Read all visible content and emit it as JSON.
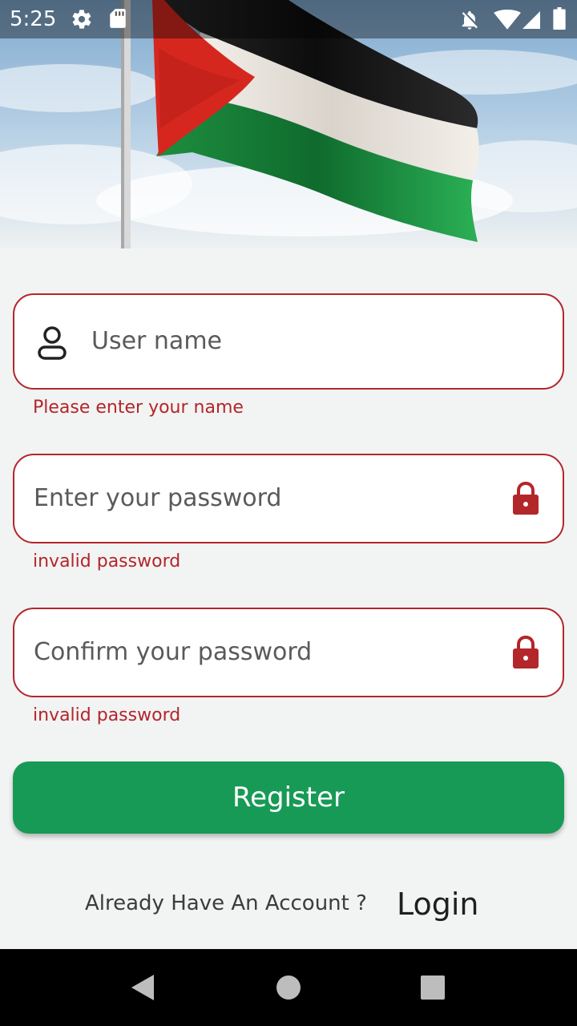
{
  "status_bar": {
    "time": "5:25",
    "icons": [
      "gear-icon",
      "sd-card-icon",
      "bell-off-icon",
      "wifi-icon",
      "signal-icon",
      "battery-icon"
    ]
  },
  "hero": {
    "description_icon": "palestine-flag-image",
    "colors": {
      "black": "#1a1a1a",
      "white": "#f2efe9",
      "green": "#1ea24f",
      "red": "#d6271f",
      "sky": "#a9c8e0"
    }
  },
  "form": {
    "username": {
      "placeholder": "User name",
      "error": "Please enter your name",
      "icon": "user-icon"
    },
    "password": {
      "placeholder": "Enter your password",
      "error": "invalid password",
      "icon": "lock-icon"
    },
    "confirm_password": {
      "placeholder": "Confirm your password",
      "error": "invalid password",
      "icon": "lock-icon"
    },
    "register_label": "Register"
  },
  "footer": {
    "prompt": "Already Have An Account ?",
    "login_label": "Login"
  },
  "colors": {
    "error": "#b3262a",
    "primary_button": "#179a55",
    "background": "#f2f3f3"
  },
  "nav_bar": {
    "icons": [
      "back-icon",
      "home-icon",
      "recents-icon"
    ]
  }
}
